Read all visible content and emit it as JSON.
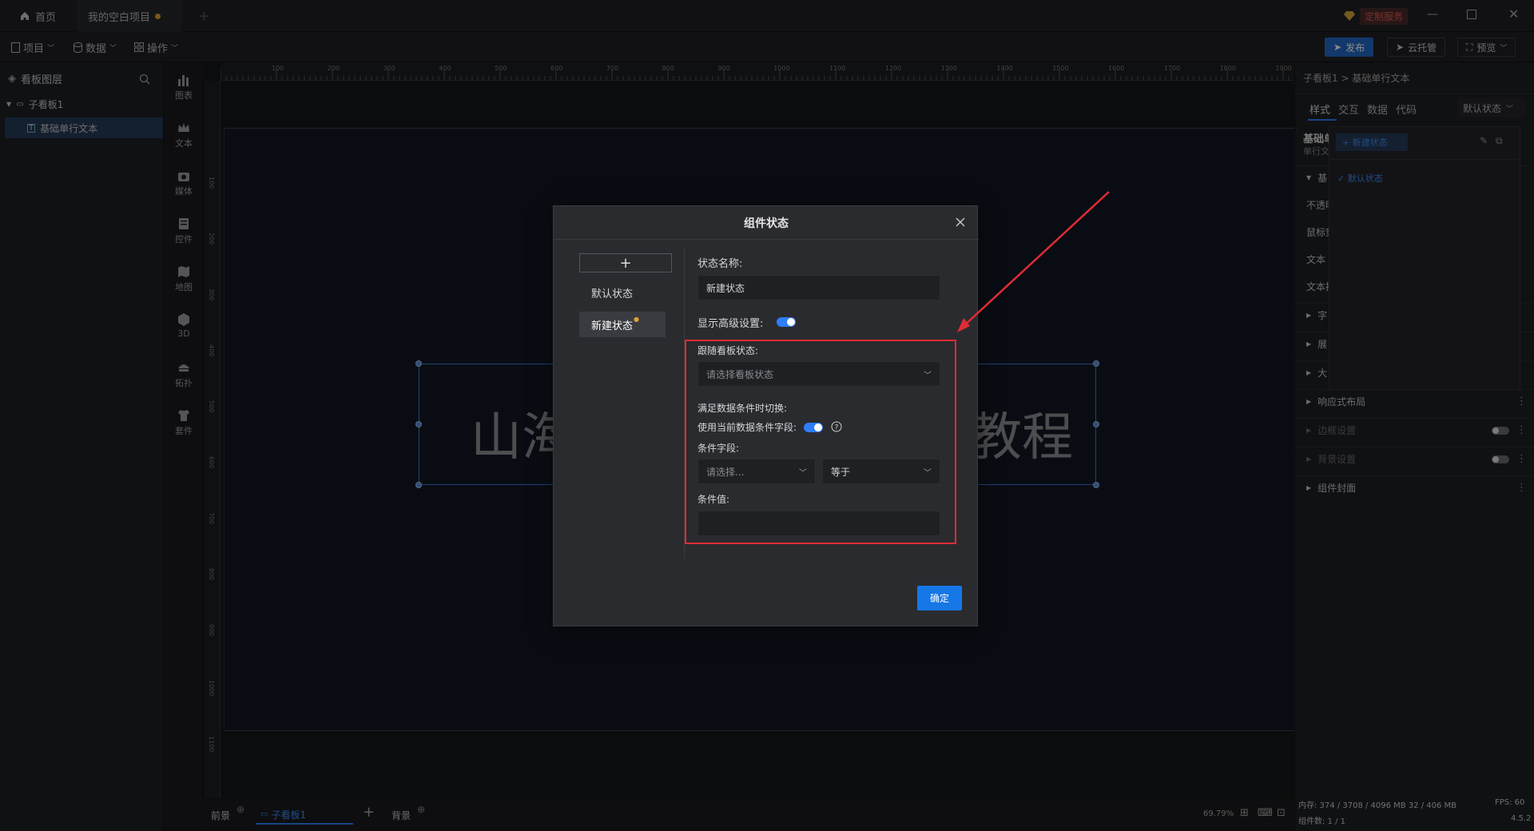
{
  "titlebar": {
    "home_label": "首页",
    "project_tab": "我的空白项目",
    "custom_service": "定制服务"
  },
  "menubar": {
    "project": "项目",
    "data": "数据",
    "operate": "操作",
    "publish": "发布",
    "cloud_host": "云托管",
    "preview": "预览"
  },
  "layers": {
    "title": "看板图层",
    "board": "子看板1",
    "item": "基础单行文本"
  },
  "toolbox": [
    "图表",
    "文本",
    "媒体",
    "控件",
    "地图",
    "3D",
    "拓扑",
    "套件"
  ],
  "ruler_h": [
    "100",
    "200",
    "300",
    "400",
    "500",
    "600",
    "700",
    "800",
    "900",
    "1000",
    "1100",
    "1200",
    "1300",
    "1400",
    "1500",
    "1600",
    "1700",
    "1800",
    "1900"
  ],
  "ruler_v": [
    "100",
    "200",
    "300",
    "400",
    "500",
    "600",
    "700",
    "800",
    "900",
    "1000",
    "1100"
  ],
  "canvas": {
    "text_left": "山海",
    "text_right": "教程"
  },
  "modal": {
    "title": "组件状态",
    "add_symbol": "+",
    "states": [
      "默认状态",
      "新建状态"
    ],
    "state_name_label": "状态名称:",
    "state_name_value": "新建状态",
    "advanced_label": "显示高级设置:",
    "follow_label": "跟随看板状态:",
    "follow_placeholder": "请选择看板状态",
    "switch_label": "满足数据条件时切换:",
    "use_field_label": "使用当前数据条件字段:",
    "cond_field_label": "条件字段:",
    "cond_field_placeholder": "请选择...",
    "operator": "等于",
    "cond_value_label": "条件值:",
    "confirm": "确定"
  },
  "bottom": {
    "front": "前景",
    "board_tab": "子看板1",
    "back": "背景",
    "zoom": "69.79%"
  },
  "rightpanel": {
    "breadcrumb": "子看板1 > 基础单行文本",
    "tabs": [
      "样式",
      "交互",
      "数据",
      "代码"
    ],
    "state_select": "默认状态",
    "comp_name": "基础单",
    "comp_sub": "单行文",
    "new_state": "+ 新建状态",
    "default_state": "✓ 默认状态",
    "base_section": "基",
    "rows": [
      "不透明度",
      "鼠标穿",
      "文本",
      "文本排"
    ],
    "collapsed": [
      "字",
      "展",
      "大"
    ],
    "sections": [
      "响应式布局",
      "边框设置",
      "背景设置",
      "组件封面"
    ],
    "memory": "内存: 374 / 3708 / 4096 MB  32 / 406 MB",
    "fps": "FPS: 60",
    "component_count": "组件数: 1 / 1",
    "version": "4.5.2"
  }
}
